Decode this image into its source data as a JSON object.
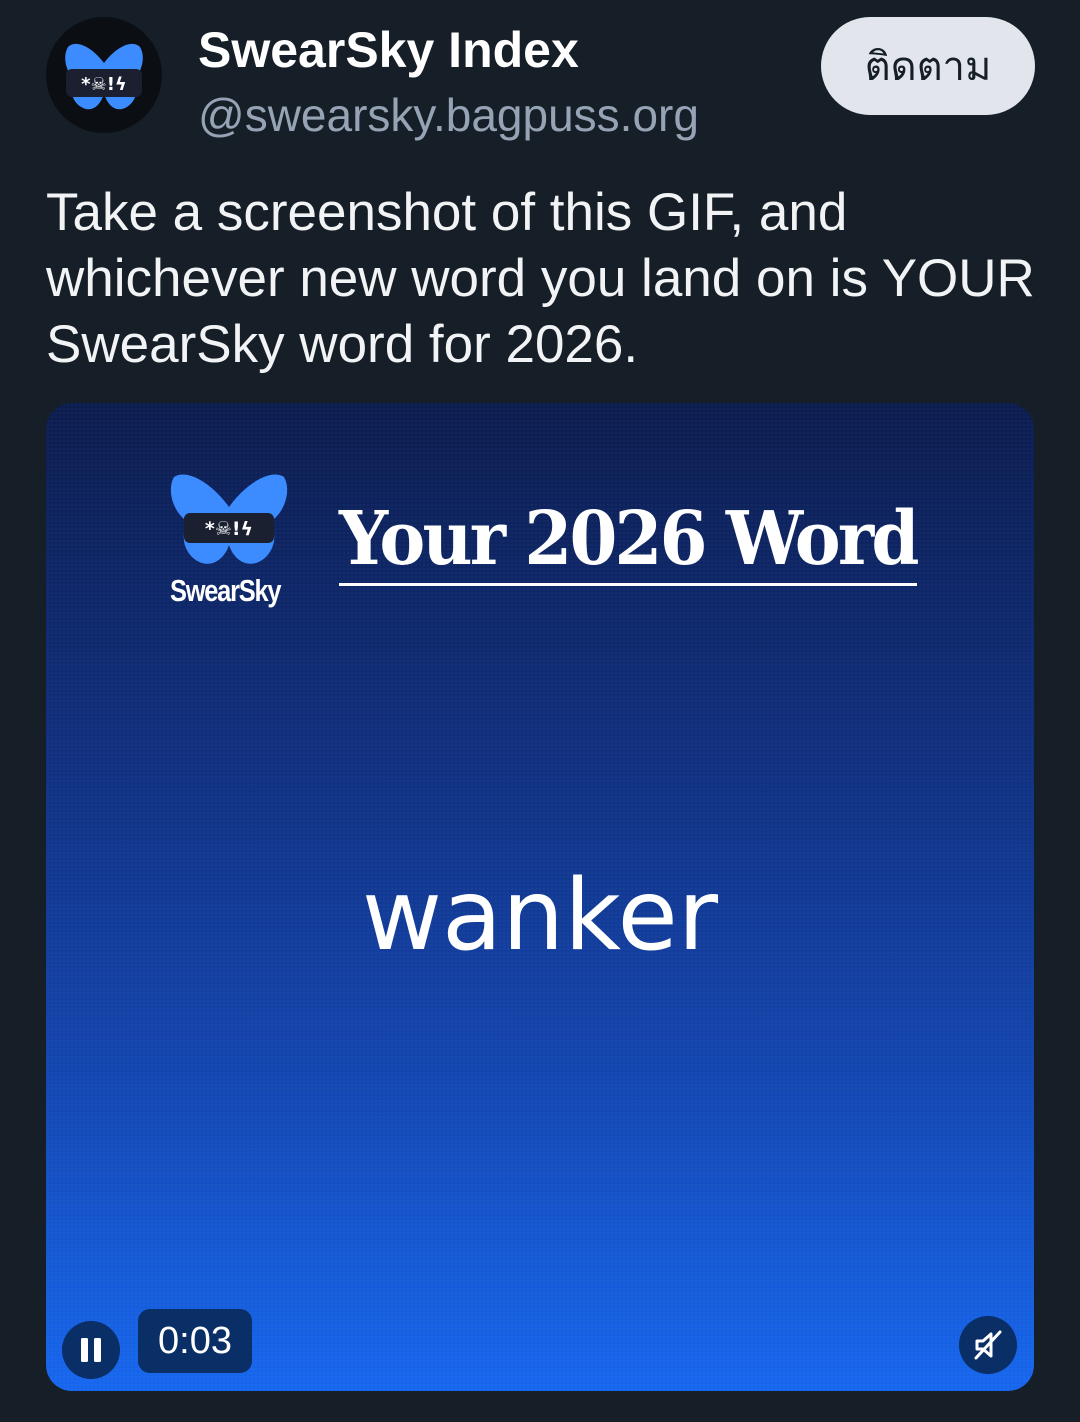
{
  "author": {
    "display_name": "SwearSky Index",
    "handle": "@swearsky.bagpuss.org",
    "avatar_icon": "butterfly-symbols-icon"
  },
  "follow_button": {
    "label": "ติดตาม"
  },
  "post": {
    "text": "Take a screenshot of this GIF, and whichever new word you land on is YOUR SwearSky word for 2026."
  },
  "media": {
    "logo_text": "SwearSky",
    "logo_icon": "swearsky-butterfly-logo-icon",
    "title": "Your 2026 Word",
    "word": "wanker",
    "playback": {
      "time": "0:03",
      "pause_icon": "pause-icon",
      "mute_icon": "muted-speaker-icon"
    }
  },
  "colors": {
    "background": "#161e27",
    "follow_button_bg": "#e2e6ec",
    "media_gradient_top": "#0c1d4f",
    "media_gradient_bottom": "#1767ee",
    "butterfly_blue": "#3d8cff"
  }
}
